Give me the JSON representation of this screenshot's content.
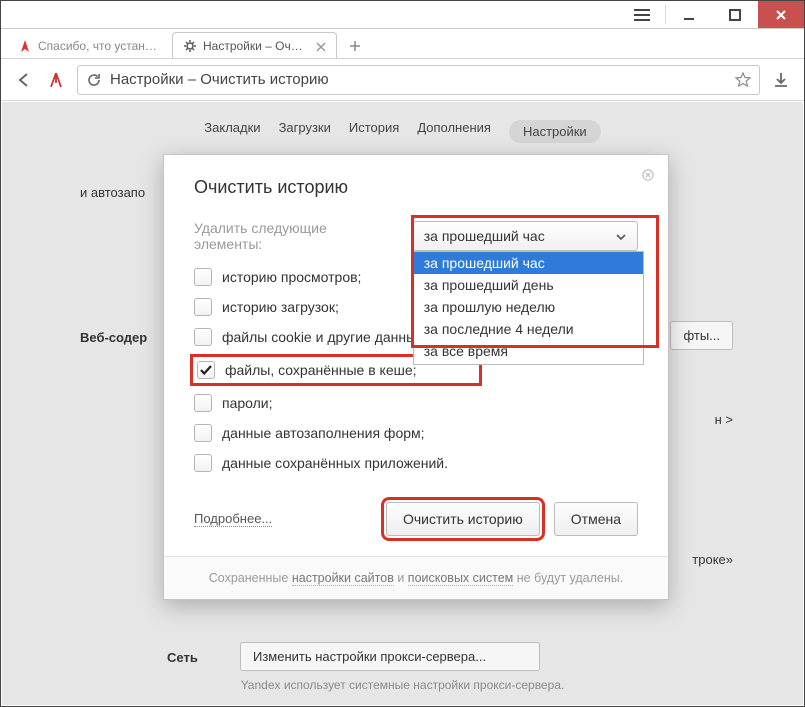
{
  "window": {
    "tabs": [
      {
        "icon": "yandex",
        "label": "Спасибо, что установи"
      },
      {
        "icon": "gear",
        "label": "Настройки – Очистит"
      }
    ],
    "url_title": "Настройки – Очистить историю"
  },
  "settings_nav": {
    "items": [
      "Закладки",
      "Загрузки",
      "История",
      "Дополнения"
    ],
    "active": "Настройки"
  },
  "bg": {
    "autolaunch_fragment": "и автозапо",
    "web_content_label": "Веб-содер",
    "fonts_btn": "фты...",
    "stroke_fragment": "троке»",
    "arrow_fragment": "н >",
    "net_label": "Сеть",
    "proxy_btn": "Изменить настройки прокси-сервера...",
    "proxy_note": "Yandex использует системные настройки прокси-сервера."
  },
  "dialog": {
    "title": "Очистить историю",
    "delete_label": "Удалить следующие элементы:",
    "select": {
      "value": "за прошедший час",
      "options": [
        "за прошедший час",
        "за прошедший день",
        "за прошлую неделю",
        "за последние 4 недели",
        "за все время"
      ]
    },
    "checks": [
      {
        "label": "историю просмотров;",
        "checked": false
      },
      {
        "label": "историю загрузок;",
        "checked": false
      },
      {
        "label": "файлы cookie и другие данные сайтов;",
        "checked": false
      },
      {
        "label": "файлы, сохранённые в кеше;",
        "checked": true,
        "highlight": true
      },
      {
        "label": "пароли;",
        "checked": false
      },
      {
        "label": "данные автозаполнения форм;",
        "checked": false
      },
      {
        "label": "данные сохранённых приложений.",
        "checked": false
      }
    ],
    "details_link": "Подробнее...",
    "clear_btn": "Очистить историю",
    "cancel_btn": "Отмена",
    "footer": {
      "pre": "Сохраненные ",
      "u1": "настройки сайтов",
      "mid": " и ",
      "u2": "поисковых систем",
      "post": " не будут удалены."
    }
  }
}
